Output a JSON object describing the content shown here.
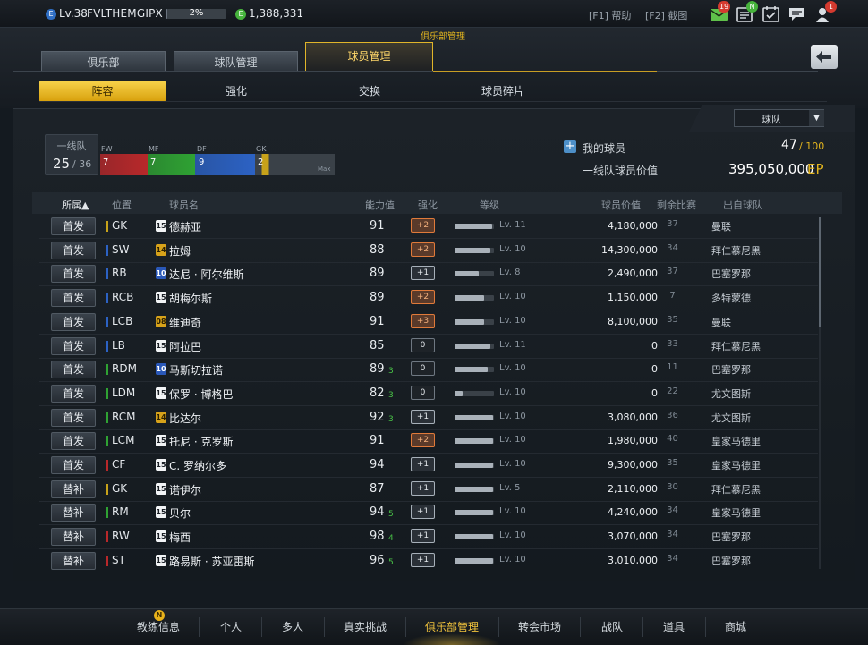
{
  "topbar": {
    "level_icon": "E",
    "level": "Lv.38",
    "username": "FVLTHEMGIPX",
    "exp_percent_label": "2%",
    "exp_percent": 2,
    "coin_icon": "E",
    "coins": "1,388,331",
    "help": "[F1] 帮助",
    "screenshot": "[F2] 截图",
    "icons": [
      {
        "name": "mail-icon",
        "badge": "19",
        "badge_color": "#d43a2f"
      },
      {
        "name": "news-icon",
        "badge": "N",
        "badge_color": "#46b33c"
      },
      {
        "name": "calendar-check-icon",
        "badge": "",
        "badge_color": ""
      },
      {
        "name": "chat-icon",
        "badge": "",
        "badge_color": ""
      },
      {
        "name": "friends-icon",
        "badge": "1",
        "badge_color": "#d43a2f"
      }
    ]
  },
  "header": {
    "section_caption": "俱乐部管理",
    "tabs": [
      "俱乐部",
      "球队管理",
      "球员管理"
    ],
    "active_tab": 2,
    "subtabs": [
      "阵容",
      "强化",
      "交换",
      "球员碎片"
    ],
    "active_subtab": 0,
    "filter_label": "球队",
    "filter_arrow": "▼"
  },
  "summary": {
    "team_label": "一线队",
    "team_count": "25",
    "team_max": "/ 36",
    "positions": [
      {
        "label": "FW",
        "count": "7",
        "color": "#b8282a"
      },
      {
        "label": "MF",
        "count": "7",
        "color": "#2fa233"
      },
      {
        "label": "DF",
        "count": "9",
        "color": "#2c62c4"
      },
      {
        "label": "GK",
        "count": "2",
        "color": "#c7a21a"
      }
    ],
    "max_label": "Max",
    "my_players_label": "我的球员",
    "my_players_count": "47",
    "my_players_max": "/ 100",
    "team_value_label": "一线队球员价值",
    "team_value": "395,050,000",
    "team_value_unit": "EP"
  },
  "table": {
    "headers": {
      "belong": "所属▲",
      "position": "位置",
      "name": "球员名",
      "ovr": "能力值",
      "enhance": "强化",
      "grade": "等级",
      "value": "球员价值",
      "games": "剩余比赛",
      "club": "出自球队"
    },
    "rows": [
      {
        "status": "首发",
        "pos": "GK",
        "pos_color": "#c7a21a",
        "season": "15",
        "season_style": "white",
        "name": "德赫亚",
        "ovr": "91",
        "ovr_up": "",
        "enh": "+2",
        "enh_style": "orange",
        "lv_fill": 0.95,
        "level": "Lv. 11",
        "value": "4,180,000",
        "games": "37",
        "club": "曼联"
      },
      {
        "status": "首发",
        "pos": "SW",
        "pos_color": "#2c62c4",
        "season": "14",
        "season_style": "gold",
        "name": "拉姆",
        "ovr": "88",
        "ovr_up": "",
        "enh": "+2",
        "enh_style": "orange",
        "lv_fill": 0.9,
        "level": "Lv. 10",
        "value": "14,300,000",
        "games": "34",
        "club": "拜仁慕尼黑"
      },
      {
        "status": "首发",
        "pos": "RB",
        "pos_color": "#2c62c4",
        "season": "10",
        "season_style": "blue",
        "name": "达尼 · 阿尔维斯",
        "ovr": "89",
        "ovr_up": "",
        "enh": "+1",
        "enh_style": "gray",
        "lv_fill": 0.62,
        "level": "Lv. 8",
        "value": "2,490,000",
        "games": "37",
        "club": "巴塞罗那"
      },
      {
        "status": "首发",
        "pos": "RCB",
        "pos_color": "#2c62c4",
        "season": "15",
        "season_style": "white",
        "name": "胡梅尔斯",
        "ovr": "89",
        "ovr_up": "",
        "enh": "+2",
        "enh_style": "orange",
        "lv_fill": 0.75,
        "level": "Lv. 10",
        "value": "1,150,000",
        "games": "7",
        "club": "多特蒙德"
      },
      {
        "status": "首发",
        "pos": "LCB",
        "pos_color": "#2c62c4",
        "season": "08",
        "season_style": "gold",
        "name": "维迪奇",
        "ovr": "91",
        "ovr_up": "",
        "enh": "+3",
        "enh_style": "orange",
        "lv_fill": 0.75,
        "level": "Lv. 10",
        "value": "8,100,000",
        "games": "35",
        "club": "曼联"
      },
      {
        "status": "首发",
        "pos": "LB",
        "pos_color": "#2c62c4",
        "season": "15",
        "season_style": "white",
        "name": "阿拉巴",
        "ovr": "85",
        "ovr_up": "",
        "enh": "0",
        "enh_style": "dark",
        "lv_fill": 0.9,
        "level": "Lv. 11",
        "value": "0",
        "games": "33",
        "club": "拜仁慕尼黑"
      },
      {
        "status": "首发",
        "pos": "RDM",
        "pos_color": "#2fa233",
        "season": "10",
        "season_style": "blue",
        "name": "马斯切拉诺",
        "ovr": "89",
        "ovr_up": "3",
        "enh": "0",
        "enh_style": "dark",
        "lv_fill": 0.85,
        "level": "Lv. 10",
        "value": "0",
        "games": "11",
        "club": "巴塞罗那"
      },
      {
        "status": "首发",
        "pos": "LDM",
        "pos_color": "#2fa233",
        "season": "15",
        "season_style": "white",
        "name": "保罗 · 博格巴",
        "ovr": "82",
        "ovr_up": "3",
        "enh": "0",
        "enh_style": "dark",
        "lv_fill": 0.2,
        "level": "Lv. 10",
        "value": "0",
        "games": "22",
        "club": "尤文图斯"
      },
      {
        "status": "首发",
        "pos": "RCM",
        "pos_color": "#2fa233",
        "season": "14",
        "season_style": "gold",
        "name": "比达尔",
        "ovr": "92",
        "ovr_up": "3",
        "enh": "+1",
        "enh_style": "gray",
        "lv_fill": 0.98,
        "level": "Lv. 10",
        "value": "3,080,000",
        "games": "36",
        "club": "尤文图斯"
      },
      {
        "status": "首发",
        "pos": "LCM",
        "pos_color": "#2fa233",
        "season": "15",
        "season_style": "white",
        "name": "托尼 · 克罗斯",
        "ovr": "91",
        "ovr_up": "",
        "enh": "+2",
        "enh_style": "orange",
        "lv_fill": 0.98,
        "level": "Lv. 10",
        "value": "1,980,000",
        "games": "40",
        "club": "皇家马德里"
      },
      {
        "status": "首发",
        "pos": "CF",
        "pos_color": "#b8282a",
        "season": "15",
        "season_style": "white",
        "name": "C. 罗纳尔多",
        "ovr": "94",
        "ovr_up": "",
        "enh": "+1",
        "enh_style": "gray",
        "lv_fill": 0.98,
        "level": "Lv. 10",
        "value": "9,300,000",
        "games": "35",
        "club": "皇家马德里"
      },
      {
        "status": "替补",
        "pos": "GK",
        "pos_color": "#c7a21a",
        "season": "15",
        "season_style": "white",
        "name": "诺伊尔",
        "ovr": "87",
        "ovr_up": "",
        "enh": "+1",
        "enh_style": "gray",
        "lv_fill": 0.98,
        "level": "Lv. 5",
        "value": "2,110,000",
        "games": "30",
        "club": "拜仁慕尼黑"
      },
      {
        "status": "替补",
        "pos": "RM",
        "pos_color": "#2fa233",
        "season": "15",
        "season_style": "white",
        "name": "贝尔",
        "ovr": "94",
        "ovr_up": "5",
        "enh": "+1",
        "enh_style": "gray",
        "lv_fill": 0.98,
        "level": "Lv. 10",
        "value": "4,240,000",
        "games": "34",
        "club": "皇家马德里"
      },
      {
        "status": "替补",
        "pos": "RW",
        "pos_color": "#b8282a",
        "season": "15",
        "season_style": "white",
        "name": "梅西",
        "ovr": "98",
        "ovr_up": "4",
        "enh": "+1",
        "enh_style": "gray",
        "lv_fill": 0.98,
        "level": "Lv. 10",
        "value": "3,070,000",
        "games": "34",
        "club": "巴塞罗那"
      },
      {
        "status": "替补",
        "pos": "ST",
        "pos_color": "#b8282a",
        "season": "15",
        "season_style": "white",
        "name": "路易斯 · 苏亚雷斯",
        "ovr": "96",
        "ovr_up": "5",
        "enh": "+1",
        "enh_style": "gray",
        "lv_fill": 0.98,
        "level": "Lv. 10",
        "value": "3,010,000",
        "games": "34",
        "club": "巴塞罗那"
      }
    ]
  },
  "bottomnav": {
    "items": [
      "教练信息",
      "个人",
      "多人",
      "真实挑战",
      "俱乐部管理",
      "转会市场",
      "战队",
      "道具",
      "商城"
    ],
    "active": 4,
    "badge": "N"
  }
}
